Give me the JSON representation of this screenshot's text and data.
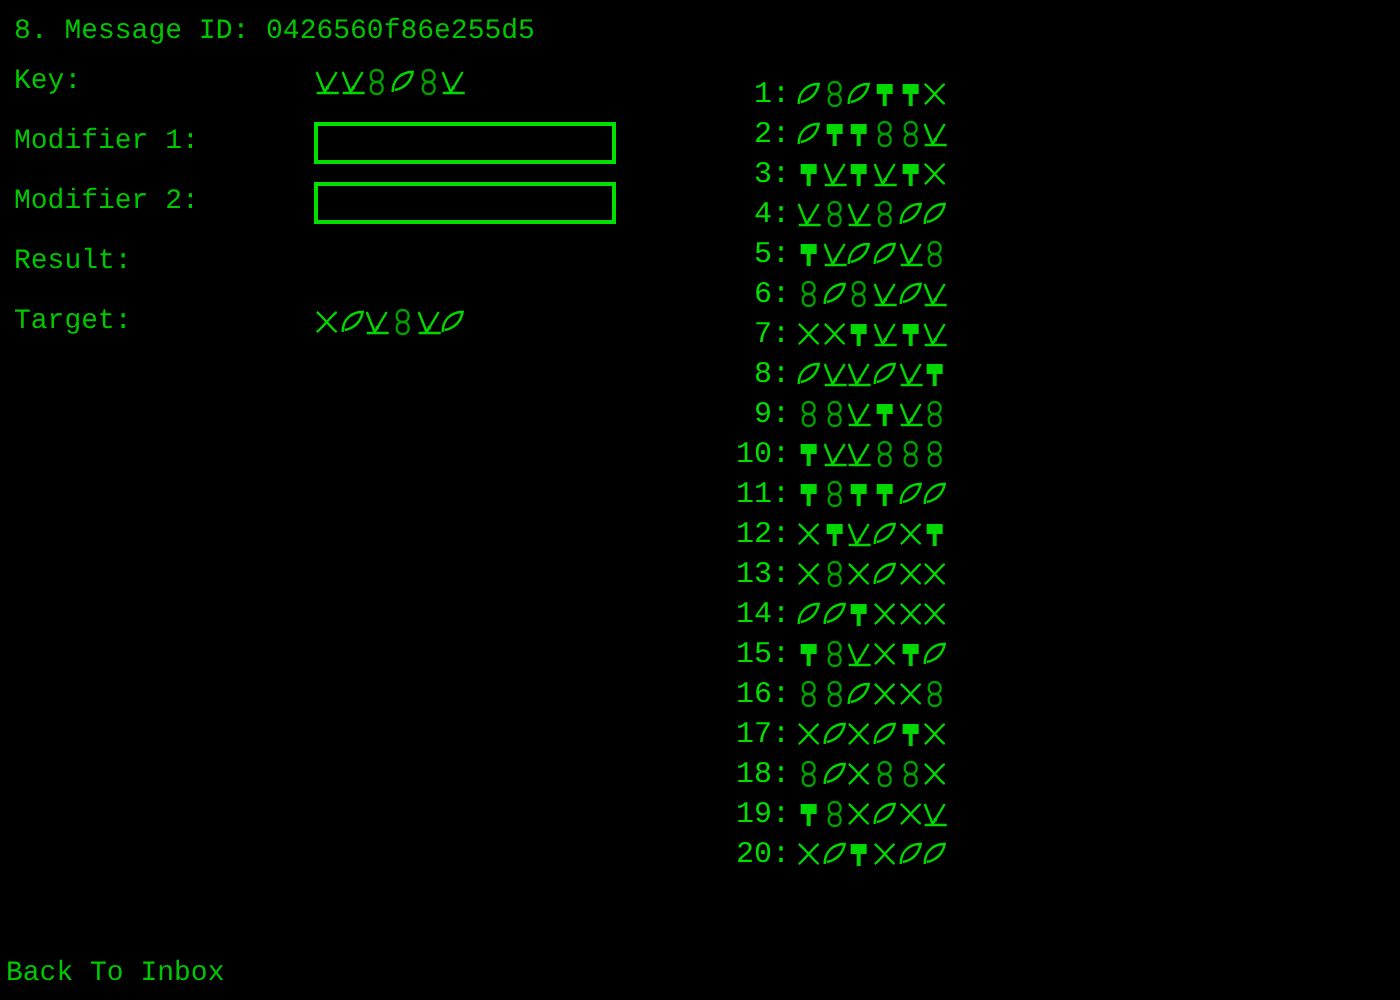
{
  "title": "8. Message ID: 0426560f86e255d5",
  "fields": [
    {
      "label": "Key:",
      "kind": "glyphs",
      "glyphs": [
        {
          "kind": "check"
        },
        {
          "kind": "check"
        },
        {
          "kind": "eight"
        },
        {
          "kind": "leaf"
        },
        {
          "kind": "eight"
        },
        {
          "kind": "check"
        }
      ]
    },
    {
      "label": "Modifier 1:",
      "kind": "input"
    },
    {
      "label": "Modifier 2:",
      "kind": "input"
    },
    {
      "label": "Result:",
      "kind": "empty"
    },
    {
      "label": "Target:",
      "kind": "glyphs",
      "glyphs": [
        {
          "kind": "cross"
        },
        {
          "kind": "leaf"
        },
        {
          "kind": "check"
        },
        {
          "kind": "eight"
        },
        {
          "kind": "check"
        },
        {
          "kind": "leaf"
        }
      ]
    }
  ],
  "sequences": [
    {
      "number": "1:",
      "glyphs": [
        {
          "kind": "leaf"
        },
        {
          "kind": "eight"
        },
        {
          "kind": "leaf"
        },
        {
          "kind": "pin"
        },
        {
          "kind": "pin"
        },
        {
          "kind": "cross"
        }
      ]
    },
    {
      "number": "2:",
      "glyphs": [
        {
          "kind": "leaf"
        },
        {
          "kind": "pin"
        },
        {
          "kind": "pin"
        },
        {
          "kind": "eight"
        },
        {
          "kind": "eight"
        },
        {
          "kind": "check"
        }
      ]
    },
    {
      "number": "3:",
      "glyphs": [
        {
          "kind": "pin"
        },
        {
          "kind": "check"
        },
        {
          "kind": "pin"
        },
        {
          "kind": "check"
        },
        {
          "kind": "pin"
        },
        {
          "kind": "cross"
        }
      ]
    },
    {
      "number": "4:",
      "glyphs": [
        {
          "kind": "check"
        },
        {
          "kind": "eight"
        },
        {
          "kind": "check"
        },
        {
          "kind": "eight"
        },
        {
          "kind": "leaf"
        },
        {
          "kind": "leaf"
        }
      ]
    },
    {
      "number": "5:",
      "glyphs": [
        {
          "kind": "pin"
        },
        {
          "kind": "check"
        },
        {
          "kind": "leaf"
        },
        {
          "kind": "leaf"
        },
        {
          "kind": "check"
        },
        {
          "kind": "eight"
        }
      ]
    },
    {
      "number": "6:",
      "glyphs": [
        {
          "kind": "eight"
        },
        {
          "kind": "leaf"
        },
        {
          "kind": "eight"
        },
        {
          "kind": "check"
        },
        {
          "kind": "leaf"
        },
        {
          "kind": "check"
        }
      ]
    },
    {
      "number": "7:",
      "glyphs": [
        {
          "kind": "cross"
        },
        {
          "kind": "cross"
        },
        {
          "kind": "pin"
        },
        {
          "kind": "check"
        },
        {
          "kind": "pin"
        },
        {
          "kind": "check"
        }
      ]
    },
    {
      "number": "8:",
      "glyphs": [
        {
          "kind": "leaf"
        },
        {
          "kind": "check"
        },
        {
          "kind": "check"
        },
        {
          "kind": "leaf"
        },
        {
          "kind": "check"
        },
        {
          "kind": "pin"
        }
      ]
    },
    {
      "number": "9:",
      "glyphs": [
        {
          "kind": "eight"
        },
        {
          "kind": "eight"
        },
        {
          "kind": "check"
        },
        {
          "kind": "pin"
        },
        {
          "kind": "check"
        },
        {
          "kind": "eight"
        }
      ]
    },
    {
      "number": "10:",
      "glyphs": [
        {
          "kind": "pin"
        },
        {
          "kind": "check"
        },
        {
          "kind": "check"
        },
        {
          "kind": "eight"
        },
        {
          "kind": "eight"
        },
        {
          "kind": "eight"
        }
      ]
    },
    {
      "number": "11:",
      "glyphs": [
        {
          "kind": "pin"
        },
        {
          "kind": "eight"
        },
        {
          "kind": "pin"
        },
        {
          "kind": "pin"
        },
        {
          "kind": "leaf"
        },
        {
          "kind": "leaf"
        }
      ]
    },
    {
      "number": "12:",
      "glyphs": [
        {
          "kind": "cross"
        },
        {
          "kind": "pin"
        },
        {
          "kind": "check"
        },
        {
          "kind": "leaf"
        },
        {
          "kind": "cross"
        },
        {
          "kind": "pin"
        }
      ]
    },
    {
      "number": "13:",
      "glyphs": [
        {
          "kind": "cross"
        },
        {
          "kind": "eight"
        },
        {
          "kind": "cross"
        },
        {
          "kind": "leaf"
        },
        {
          "kind": "cross"
        },
        {
          "kind": "cross"
        }
      ]
    },
    {
      "number": "14:",
      "glyphs": [
        {
          "kind": "leaf"
        },
        {
          "kind": "leaf"
        },
        {
          "kind": "pin"
        },
        {
          "kind": "cross"
        },
        {
          "kind": "cross"
        },
        {
          "kind": "cross"
        }
      ]
    },
    {
      "number": "15:",
      "glyphs": [
        {
          "kind": "pin"
        },
        {
          "kind": "eight"
        },
        {
          "kind": "check"
        },
        {
          "kind": "cross"
        },
        {
          "kind": "pin"
        },
        {
          "kind": "leaf"
        }
      ]
    },
    {
      "number": "16:",
      "glyphs": [
        {
          "kind": "eight"
        },
        {
          "kind": "eight"
        },
        {
          "kind": "leaf"
        },
        {
          "kind": "cross"
        },
        {
          "kind": "cross"
        },
        {
          "kind": "eight"
        }
      ]
    },
    {
      "number": "17:",
      "glyphs": [
        {
          "kind": "cross"
        },
        {
          "kind": "leaf"
        },
        {
          "kind": "cross"
        },
        {
          "kind": "leaf"
        },
        {
          "kind": "pin"
        },
        {
          "kind": "cross"
        }
      ]
    },
    {
      "number": "18:",
      "glyphs": [
        {
          "kind": "eight"
        },
        {
          "kind": "leaf"
        },
        {
          "kind": "cross"
        },
        {
          "kind": "eight"
        },
        {
          "kind": "eight"
        },
        {
          "kind": "cross"
        }
      ]
    },
    {
      "number": "19:",
      "glyphs": [
        {
          "kind": "pin"
        },
        {
          "kind": "eight"
        },
        {
          "kind": "cross"
        },
        {
          "kind": "leaf"
        },
        {
          "kind": "cross"
        },
        {
          "kind": "check"
        }
      ]
    },
    {
      "number": "20:",
      "glyphs": [
        {
          "kind": "cross"
        },
        {
          "kind": "leaf"
        },
        {
          "kind": "pin"
        },
        {
          "kind": "cross"
        },
        {
          "kind": "leaf"
        },
        {
          "kind": "leaf"
        }
      ]
    }
  ],
  "back_link": "Back To Inbox"
}
